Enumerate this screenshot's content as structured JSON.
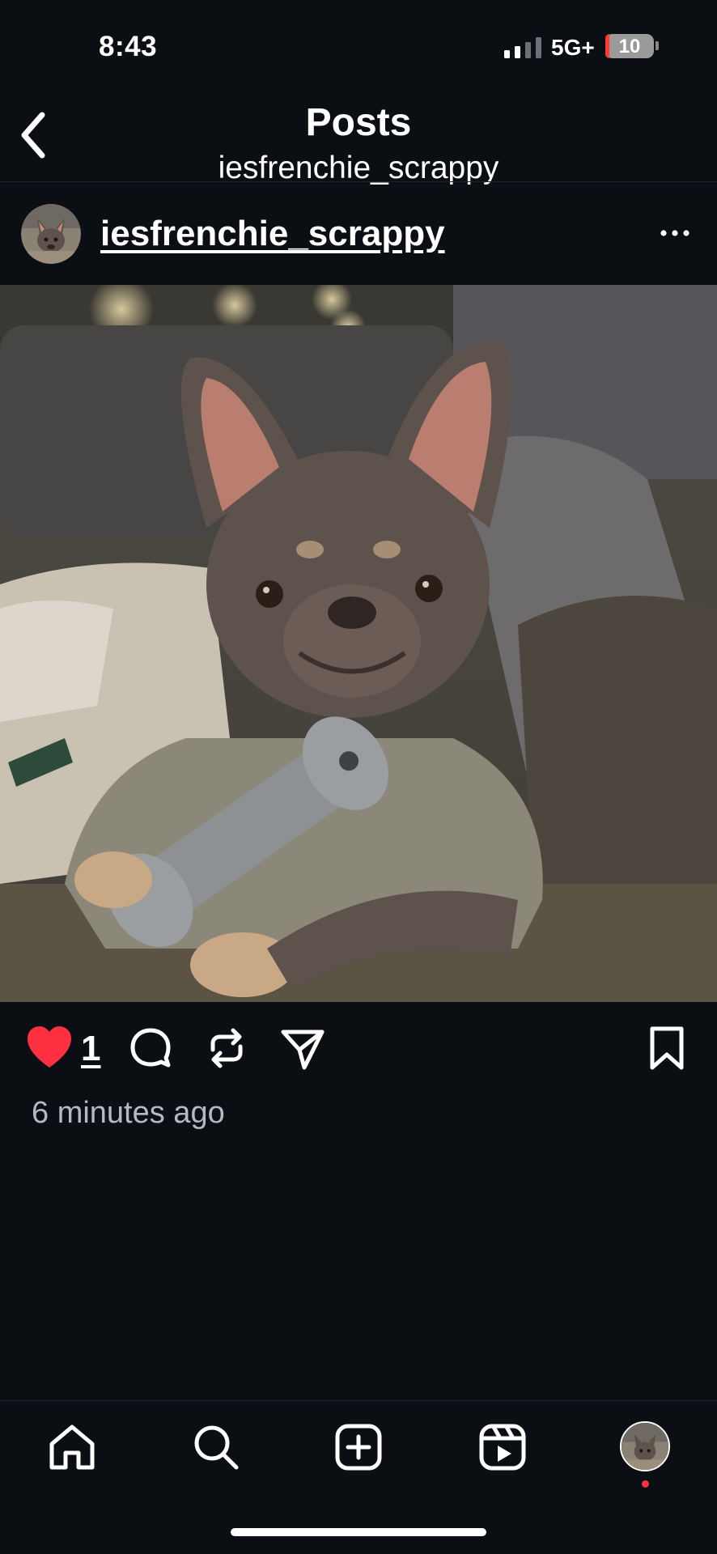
{
  "status_bar": {
    "time": "8:43",
    "network": "5G+",
    "battery": "10"
  },
  "header": {
    "title": "Posts",
    "subtitle": "iesfrenchie_scrappy"
  },
  "post": {
    "username": "iesfrenchie_scrappy",
    "like_count": "1",
    "time_ago": "6 minutes ago",
    "liked": true
  },
  "icons": {
    "back": "chevron-left-icon",
    "more": "more-horizontal-icon",
    "like": "heart-icon",
    "comment": "comment-icon",
    "repost": "repost-icon",
    "share": "send-icon",
    "save": "bookmark-icon"
  },
  "bottom_nav": {
    "items": [
      "home",
      "search",
      "create",
      "reels",
      "profile"
    ]
  },
  "colors": {
    "background": "#0b0e13",
    "like_red": "#ff3040",
    "secondary_text": "#b5b9c1"
  }
}
